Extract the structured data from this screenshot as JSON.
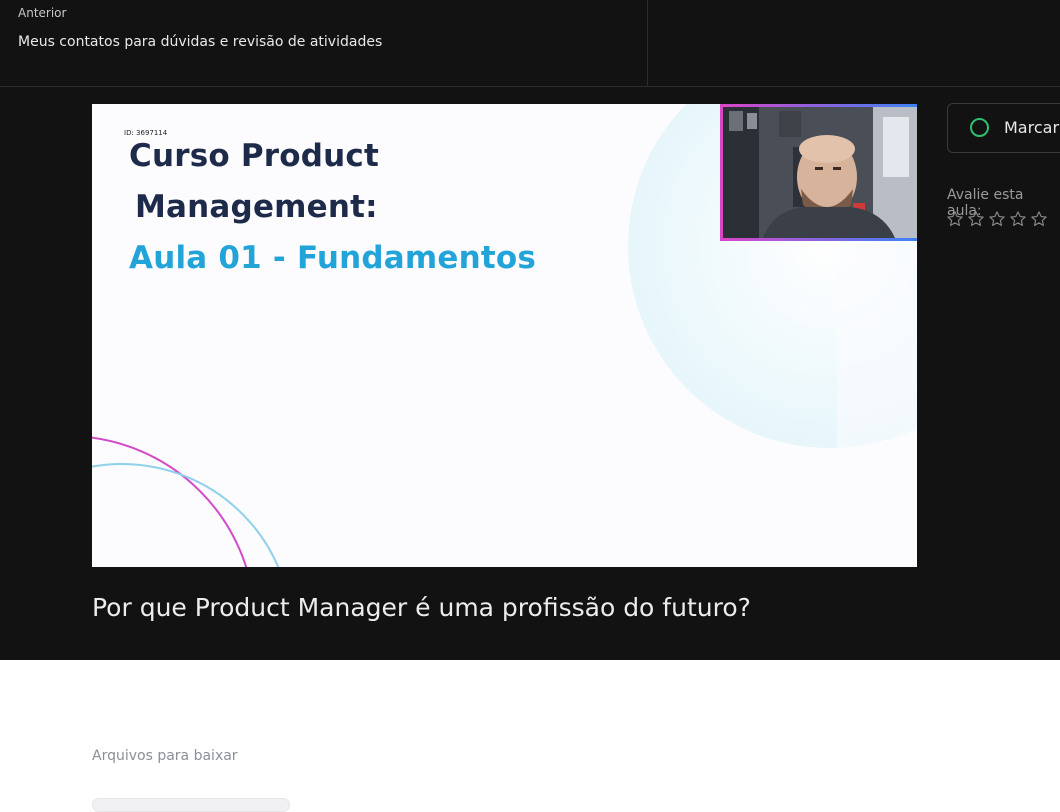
{
  "navigation": {
    "previous_label": "Anterior",
    "previous_title": "Meus contatos para dúvidas e revisão de atividades"
  },
  "video": {
    "slide_id": "ID: 3697114",
    "slide_title_line1": "Curso Product",
    "slide_title_line2": "Management:",
    "slide_title_line3": "Aula 01 - Fundamentos"
  },
  "lesson": {
    "title": "Por que Product Manager é uma profissão do futuro?"
  },
  "actions": {
    "mark_label": "Marcar",
    "rate_label": "Avalie esta aula:",
    "rating_max": 5,
    "rating_value": 0
  },
  "downloads": {
    "section_label": "Arquivos para baixar"
  },
  "colors": {
    "background_dark": "#121212",
    "accent_green": "#2fbf71",
    "slide_title_dark": "#1e2a4a",
    "slide_title_blue": "#22a4d9"
  }
}
